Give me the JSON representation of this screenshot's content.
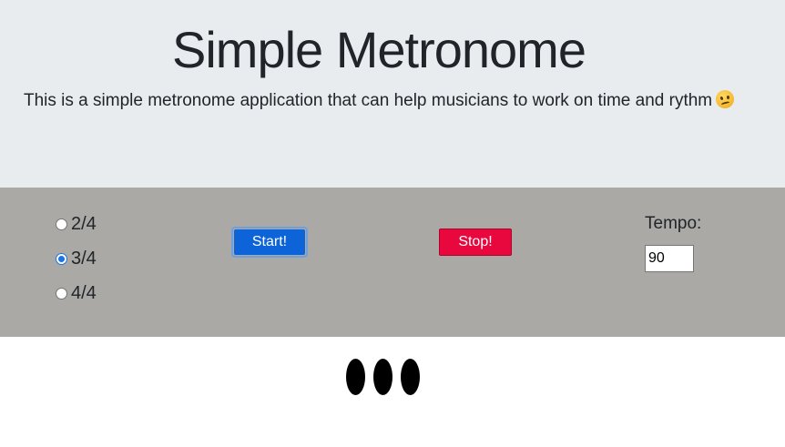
{
  "header": {
    "title": "Simple Metronome",
    "description": "This is a simple metronome application that can help musicians to work on time and rythm"
  },
  "controls": {
    "time_signatures": [
      {
        "label": "2/4",
        "checked": false
      },
      {
        "label": "3/4",
        "checked": true
      },
      {
        "label": "4/4",
        "checked": false
      }
    ],
    "start_label": "Start!",
    "stop_label": "Stop!",
    "tempo_label": "Tempo:",
    "tempo_value": "90"
  },
  "beat_indicators": {
    "count": 3
  },
  "colors": {
    "header_bg": "#e9ecef",
    "controls_bg": "#aaa9a5",
    "start_button": "#0d63d8",
    "stop_button": "#e8083e",
    "beat": "#000000"
  },
  "icons": {
    "description_emoji": "woozy-face-icon"
  }
}
